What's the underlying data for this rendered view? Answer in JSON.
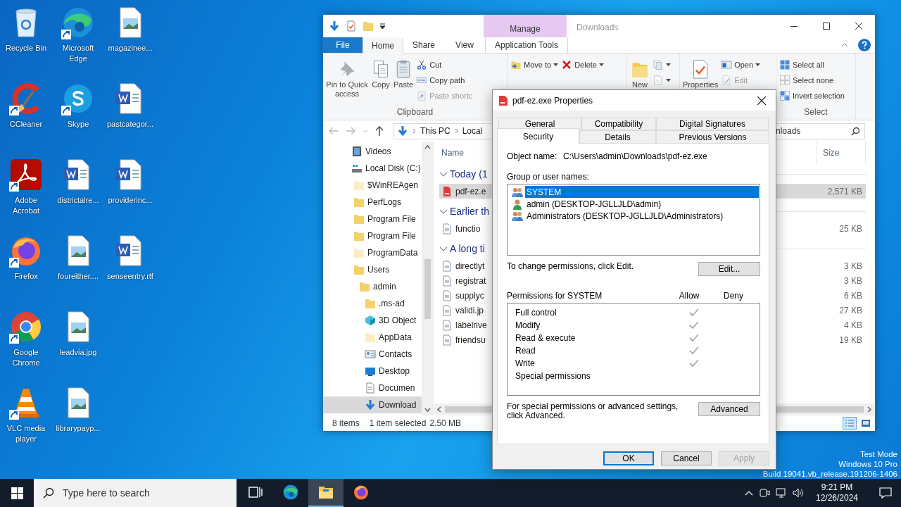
{
  "desktop": {
    "icons": [
      {
        "label": "Recycle Bin",
        "kind": "recycle",
        "shortcut": false
      },
      {
        "label": "CCleaner",
        "kind": "ccleaner",
        "shortcut": true
      },
      {
        "label": "Adobe Acrobat",
        "kind": "acrobat",
        "shortcut": true
      },
      {
        "label": "Firefox",
        "kind": "firefox",
        "shortcut": true
      },
      {
        "label": "Google Chrome",
        "kind": "chrome",
        "shortcut": true
      },
      {
        "label": "VLC media player",
        "kind": "vlc",
        "shortcut": true
      },
      {
        "label": "Microsoft Edge",
        "kind": "edge",
        "shortcut": true
      },
      {
        "label": "Skype",
        "kind": "skype",
        "shortcut": true
      },
      {
        "label": "districtalre...",
        "kind": "word",
        "shortcut": false
      },
      {
        "label": "foureither....",
        "kind": "image",
        "shortcut": false
      },
      {
        "label": "leadvia.jpg",
        "kind": "image",
        "shortcut": false
      },
      {
        "label": "librarypayp...",
        "kind": "image",
        "shortcut": false
      },
      {
        "label": "magazinee...",
        "kind": "image",
        "shortcut": false
      },
      {
        "label": "pastcategor...",
        "kind": "word",
        "shortcut": false
      },
      {
        "label": "providerinc...",
        "kind": "word",
        "shortcut": false
      },
      {
        "label": "senseentry.rtf",
        "kind": "word",
        "shortcut": false
      }
    ],
    "notice": [
      "Test Mode",
      "Windows 10 Pro",
      "Build 19041.vb_release.191206-1406"
    ]
  },
  "explorer": {
    "title": "Downloads",
    "context_label": "Manage",
    "tabs": [
      {
        "label": "File",
        "kind": "file",
        "selected": false
      },
      {
        "label": "Home",
        "kind": "plain",
        "selected": true
      },
      {
        "label": "Share",
        "kind": "plain",
        "selected": false
      },
      {
        "label": "View",
        "kind": "plain",
        "selected": false
      },
      {
        "label": "Application Tools",
        "kind": "context",
        "selected": false
      }
    ],
    "ribbon": [
      {
        "label": "Clipboard",
        "columns": [
          {
            "items": [
              {
                "label": "Pin to Quick access",
                "kind": "large",
                "disabled": false
              }
            ]
          },
          {
            "items": [
              {
                "label": "Copy",
                "kind": "large",
                "disabled": false
              }
            ]
          },
          {
            "items": [
              {
                "label": "Paste",
                "kind": "large",
                "disabled": false
              }
            ]
          },
          {
            "items": [
              {
                "label": "Cut",
                "kind": "small",
                "disabled": false
              },
              {
                "label": "Copy path",
                "kind": "small",
                "disabled": false
              },
              {
                "label": "Paste shortc",
                "kind": "small",
                "disabled": true
              }
            ]
          }
        ]
      },
      {
        "columns": [
          {
            "items": [
              {
                "label": "Move to",
                "kind": "menu",
                "disabled": false
              }
            ]
          },
          {
            "items": [
              {
                "label": "Delete",
                "kind": "menu",
                "disabled": false
              }
            ]
          }
        ]
      },
      {
        "columns": [
          {
            "items": [
              {
                "label": "New",
                "kind": "large",
                "disabled": false
              }
            ]
          },
          {
            "items": [
              {
                "kind": "iconmenu"
              },
              {
                "kind": "iconmenu"
              }
            ]
          }
        ]
      },
      {
        "columns": [
          {
            "items": [
              {
                "label": "Properties",
                "kind": "large",
                "disabled": false
              }
            ]
          },
          {
            "items": [
              {
                "label": "Open",
                "kind": "menu",
                "disabled": false
              },
              {
                "label": "Edit",
                "kind": "small",
                "disabled": true
              }
            ]
          }
        ]
      },
      {
        "label": "Select",
        "columns": [
          {
            "items": [
              {
                "label": "Select all",
                "kind": "small",
                "disabled": false
              },
              {
                "label": "Select none",
                "kind": "small",
                "disabled": false
              },
              {
                "label": "Invert selection",
                "kind": "small",
                "disabled": false
              }
            ]
          }
        ]
      }
    ],
    "address": [
      "This PC",
      "Local"
    ],
    "search_value": "nloads",
    "tree": [
      {
        "label": "Videos",
        "kind": "videos",
        "selected": false
      },
      {
        "label": "Local Disk (C:)",
        "kind": "drive",
        "selected": false,
        "children": [
          {
            "label": "$WinREAgen",
            "kind": "folder-faded",
            "selected": false
          },
          {
            "label": "PerfLogs",
            "kind": "folder",
            "selected": false
          },
          {
            "label": "Program File",
            "kind": "folder",
            "selected": false
          },
          {
            "label": "Program File",
            "kind": "folder",
            "selected": false
          },
          {
            "label": "ProgramData",
            "kind": "folder-faded",
            "selected": false
          },
          {
            "label": "Users",
            "kind": "folder",
            "selected": false,
            "children": [
              {
                "label": "admin",
                "kind": "folder",
                "selected": false,
                "children": [
                  {
                    "label": ".ms-ad",
                    "kind": "folder",
                    "selected": false
                  },
                  {
                    "label": "3D Object",
                    "kind": "objects",
                    "selected": false
                  },
                  {
                    "label": "AppData",
                    "kind": "folder-faded",
                    "selected": false
                  },
                  {
                    "label": "Contacts",
                    "kind": "contacts",
                    "selected": false
                  },
                  {
                    "label": "Desktop",
                    "kind": "desktop",
                    "selected": false
                  },
                  {
                    "label": "Documen",
                    "kind": "documents",
                    "selected": false
                  },
                  {
                    "label": "Download",
                    "kind": "downloads",
                    "selected": true
                  }
                ]
              }
            ]
          }
        ]
      }
    ],
    "columns": [
      {
        "label": "Name"
      },
      {
        "label": "Size"
      }
    ],
    "groups": [
      {
        "label": "Today (1",
        "expanded": true,
        "files": [
          {
            "name": "pdf-ez.e",
            "size": "2,571 KB",
            "kind": "pdf",
            "selected": true
          }
        ]
      },
      {
        "label": "Earlier th",
        "expanded": true,
        "files": [
          {
            "name": "functio",
            "size": "25 KB",
            "kind": "doc",
            "selected": false
          }
        ]
      },
      {
        "label": "A long ti",
        "expanded": true,
        "files": [
          {
            "name": "directlyt",
            "size": "3 KB",
            "kind": "doc",
            "selected": false
          },
          {
            "name": "registrat",
            "size": "3 KB",
            "kind": "doc",
            "selected": false
          },
          {
            "name": "supplyc",
            "size": "6 KB",
            "kind": "doc",
            "selected": false
          },
          {
            "name": "validi.jp",
            "size": "27 KB",
            "kind": "doc",
            "selected": false
          },
          {
            "name": "labelrive",
            "size": "4 KB",
            "kind": "doc",
            "selected": false
          },
          {
            "name": "friendsu",
            "size": "19 KB",
            "kind": "doc",
            "selected": false
          }
        ]
      }
    ],
    "status": {
      "count": "8 items",
      "selection": "1 item selected",
      "size": "2.50 MB"
    },
    "views": [
      {
        "kind": "details",
        "selected": true
      },
      {
        "kind": "large",
        "selected": false
      }
    ]
  },
  "dialog": {
    "title": "pdf-ez.exe Properties",
    "tab_rows": [
      {
        "tabs": [
          {
            "label": "General",
            "selected": false
          },
          {
            "label": "Compatibility",
            "selected": false
          },
          {
            "label": "Digital Signatures",
            "selected": false
          }
        ]
      },
      {
        "tabs": [
          {
            "label": "Security",
            "selected": true
          },
          {
            "label": "Details",
            "selected": false
          },
          {
            "label": "Previous Versions",
            "selected": false
          }
        ]
      }
    ],
    "object_label": "Object name:",
    "object_value": "C:\\Users\\admin\\Downloads\\pdf-ez.exe",
    "principals_label": "Group or user names:",
    "principals": [
      {
        "name": "SYSTEM",
        "kind": "group",
        "selected": true
      },
      {
        "name": "admin (DESKTOP-JGLLJLD\\admin)",
        "kind": "user",
        "selected": false
      },
      {
        "name": "Administrators (DESKTOP-JGLLJLD\\Administrators)",
        "kind": "group",
        "selected": false
      }
    ],
    "change_hint": "To change permissions, click Edit.",
    "edit_button": "Edit...",
    "permissions_label": "Permissions for SYSTEM",
    "allow_label": "Allow",
    "deny_label": "Deny",
    "permissions": [
      {
        "name": "Full control",
        "allow": true,
        "deny": false
      },
      {
        "name": "Modify",
        "allow": true,
        "deny": false
      },
      {
        "name": "Read & execute",
        "allow": true,
        "deny": false
      },
      {
        "name": "Read",
        "allow": true,
        "deny": false
      },
      {
        "name": "Write",
        "allow": true,
        "deny": false
      },
      {
        "name": "Special permissions",
        "allow": false,
        "deny": false
      }
    ],
    "advanced_hint": "For special permissions or advanced settings, click Advanced.",
    "advanced_button": "Advanced",
    "buttons": [
      {
        "label": "OK",
        "default": true,
        "disabled": false
      },
      {
        "label": "Cancel",
        "default": false,
        "disabled": false
      },
      {
        "label": "Apply",
        "default": false,
        "disabled": true
      }
    ]
  },
  "taskbar": {
    "search_placeholder": "Type here to search",
    "apps": [
      {
        "kind": "taskview",
        "active": false
      },
      {
        "kind": "edge",
        "active": false
      },
      {
        "kind": "explorer",
        "active": true
      },
      {
        "kind": "firefox",
        "active": false
      }
    ],
    "time": "9:21 PM",
    "date": "12/26/2024"
  }
}
